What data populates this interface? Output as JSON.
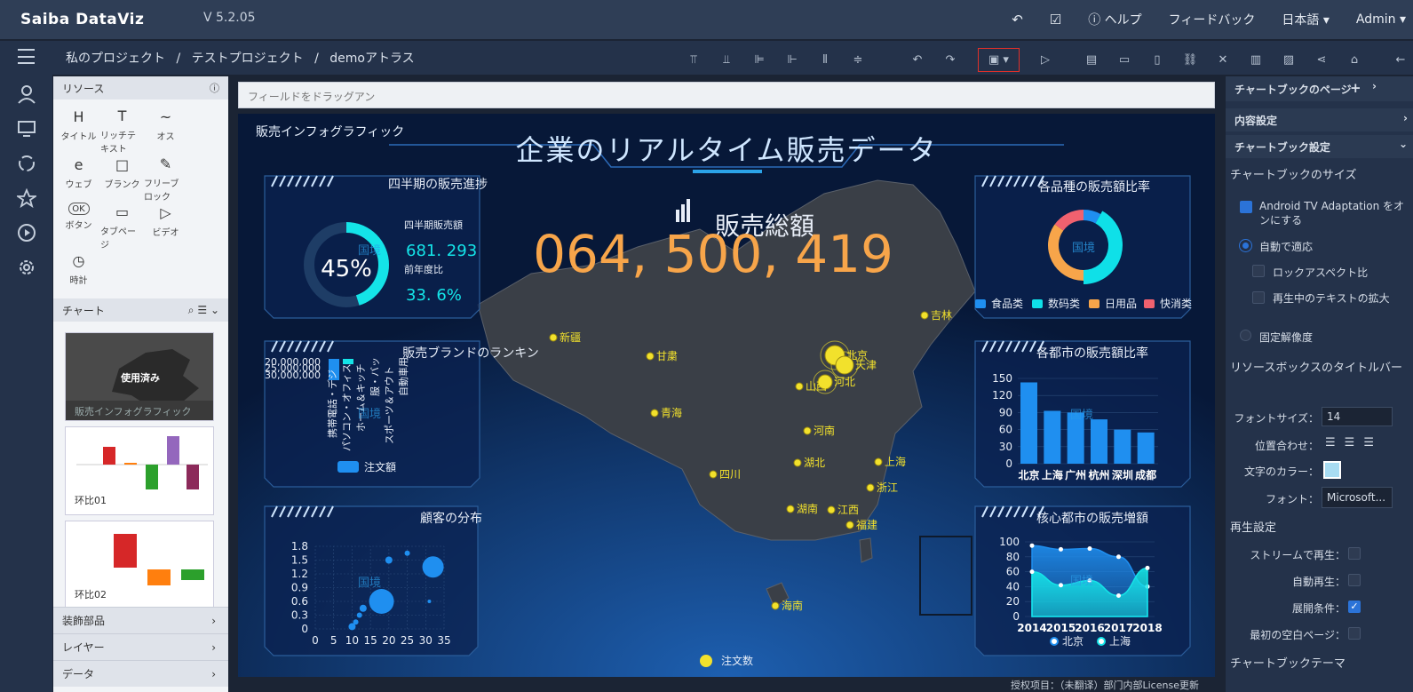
{
  "app": {
    "logo": "Saiba DataViz",
    "version": "V 5.2.05"
  },
  "topbar": {
    "help": "ヘルプ",
    "feedback": "フィードバック",
    "language": "日本語",
    "user": "Admin"
  },
  "breadcrumb": {
    "items": [
      "私のプロジェクト",
      "テストプロジェクト",
      "demoアトラス"
    ],
    "separator": "/"
  },
  "resources": {
    "title": "リソース",
    "items": [
      {
        "label": "タイトル",
        "icon": "H"
      },
      {
        "label": "リッチテキスト",
        "icon": "T"
      },
      {
        "label": "オス",
        "icon": "~"
      },
      {
        "label": "ウェブ",
        "icon": "e"
      },
      {
        "label": "ブランク",
        "icon": "□"
      },
      {
        "label": "フリーブロック",
        "icon": "✎"
      },
      {
        "label": "ボタン",
        "icon": "OK"
      },
      {
        "label": "タブページ",
        "icon": "▭"
      },
      {
        "label": "ビデオ",
        "icon": "▷"
      },
      {
        "label": "時計",
        "icon": "◷"
      }
    ]
  },
  "charts_section": {
    "title": "チャート",
    "thumbs": [
      {
        "label": "販売インフォグラフィック",
        "badge": "使用済み"
      },
      {
        "label": "环比01"
      },
      {
        "label": "环比02"
      }
    ]
  },
  "bottom_sections": [
    "装飾部品",
    "レイヤー",
    "データ"
  ],
  "canvas": {
    "drop_hint": "フィールドをドラッグアン"
  },
  "dashboard": {
    "top_left_label": "販売インフォグラフィック",
    "main_title": "企業のリアルタイム販売データ",
    "total_label": "販売総額",
    "total_value": "064, 500, 419",
    "watermark": "国境",
    "progress_panel": {
      "title": "四半期の販売進捗",
      "percent_text": "45%",
      "percent": 45,
      "sales_label": "四半期販売額",
      "sales_value": "681. 293",
      "yoy_label": "前年度比",
      "yoy_value": "33. 6%"
    },
    "brand_panel": {
      "title": "販売ブランドのランキン",
      "ticks": [
        "20,000,000",
        "25,000,000",
        "30,000,000"
      ],
      "categories": [
        "携帯電話・デジ",
        "パソコン・オフィス",
        "ホーム＆キッチ",
        "服・バッ",
        "スポーツ＆アウト",
        "自動車用"
      ],
      "legend": "注文額"
    },
    "customer_panel": {
      "title": "顧客の分布"
    },
    "category_panel": {
      "title": "各品種の販売額比率",
      "legend": [
        "食品类",
        "数码类",
        "日用品",
        "快消类"
      ]
    },
    "city_panel": {
      "title": "各都市の販売額比率"
    },
    "growth_panel": {
      "title": "核心都市の販売増額",
      "legend": [
        "北京",
        "上海"
      ]
    },
    "map": {
      "cities": [
        {
          "name": "新疆"
        },
        {
          "name": "甘粛"
        },
        {
          "name": "青海"
        },
        {
          "name": "四川"
        },
        {
          "name": "北京"
        },
        {
          "name": "天津"
        },
        {
          "name": "河北"
        },
        {
          "name": "山西"
        },
        {
          "name": "吉林"
        },
        {
          "name": "河南"
        },
        {
          "name": "湖北"
        },
        {
          "name": "上海"
        },
        {
          "name": "浙江"
        },
        {
          "name": "湖南"
        },
        {
          "name": "江西"
        },
        {
          "name": "福建"
        },
        {
          "name": "海南"
        }
      ],
      "legend": "注文数"
    },
    "footer_text": "授权项目：（未翻译）部门内部License更新"
  },
  "chart_data": [
    {
      "type": "bar",
      "title": "各都市の販売額比率",
      "categories": [
        "北京",
        "上海",
        "广州",
        "杭州",
        "深圳",
        "成都"
      ],
      "values": [
        143,
        93,
        90,
        78,
        60,
        55
      ],
      "ylim": [
        0,
        150
      ],
      "yticks": [
        0,
        30,
        60,
        90,
        120,
        150
      ]
    },
    {
      "type": "area",
      "title": "核心都市の販売増額",
      "x": [
        "2014",
        "2015",
        "2016",
        "2017",
        "2018"
      ],
      "series": [
        {
          "name": "北京",
          "values": [
            95,
            90,
            91,
            80,
            40
          ]
        },
        {
          "name": "上海",
          "values": [
            60,
            42,
            48,
            28,
            65
          ]
        }
      ],
      "ylim": [
        0,
        100
      ],
      "yticks": [
        0,
        20,
        40,
        60,
        80,
        100
      ]
    },
    {
      "type": "scatter",
      "title": "顧客の分布",
      "points": [
        [
          10,
          0.05,
          4
        ],
        [
          11,
          0.15,
          3
        ],
        [
          12,
          0.3,
          3
        ],
        [
          13,
          0.45,
          4
        ],
        [
          18,
          0.6,
          14
        ],
        [
          20,
          1.5,
          4
        ],
        [
          25,
          1.65,
          3
        ],
        [
          31,
          0.6,
          2
        ],
        [
          32,
          1.35,
          12
        ]
      ],
      "xlim": [
        0,
        35
      ],
      "xticks": [
        0,
        5,
        10,
        15,
        20,
        25,
        30,
        35
      ],
      "ylim": [
        0,
        1.8
      ],
      "yticks": [
        0,
        0.3,
        0.6,
        0.9,
        1.2,
        1.5,
        1.8
      ]
    },
    {
      "type": "pie",
      "title": "各品種の販売額比率",
      "categories": [
        "食品类",
        "数码类",
        "日用品",
        "快消类"
      ],
      "values": [
        8,
        42,
        35,
        15
      ],
      "colors": [
        "#1f8ff0",
        "#0fe0e8",
        "#f7a54a",
        "#f0616f"
      ]
    }
  ],
  "right_panel": {
    "header": "チャートブックのページ",
    "content_settings": "内容設定",
    "book_settings": "チャートブック設定",
    "size_label": "チャートブックのサイズ",
    "android": "Android TV Adaptation をオンにする",
    "auto_fit": "自動で適応",
    "lock_aspect": "ロックアスペクト比",
    "text_zoom": "再生中のテキストの拡大",
    "fixed_res": "固定解像度",
    "title_bar": "リソースボックスのタイトルバー",
    "font_size_label": "フォントサイズ：",
    "font_size_value": "14",
    "align_label": "位置合わせ：",
    "color_label": "文字のカラー：",
    "font_label": "フォント：",
    "font_value": "Microsoft...",
    "playback": "再生設定",
    "stream": "ストリームで再生：",
    "autoplay": "自動再生：",
    "expand": "展開条件：",
    "first_blank": "最初の空白ページ：",
    "theme": "チャートブックテーマ"
  },
  "colors": {
    "accent": "#2b73d8",
    "highlight": "#e0302a",
    "cyan": "#14e4e8",
    "orange": "#f7a54a",
    "yellow": "#f2e12c"
  }
}
